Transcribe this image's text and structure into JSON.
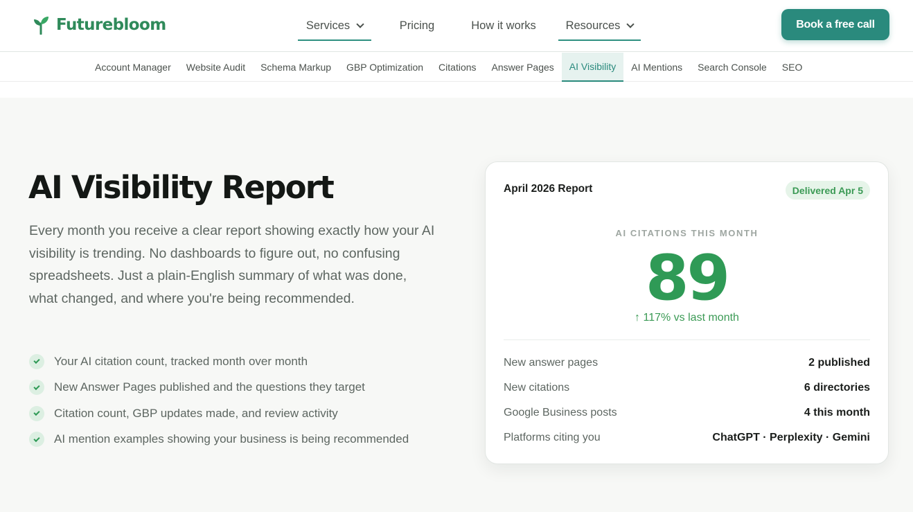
{
  "brand": {
    "name": "Futurebloom",
    "logo_icon": "sprout-icon"
  },
  "nav": {
    "items": [
      {
        "label": "Services",
        "has_dropdown": true
      },
      {
        "label": "Pricing"
      },
      {
        "label": "How it works"
      },
      {
        "label": "Resources",
        "has_dropdown": true
      }
    ],
    "cta_label": "Book a free call"
  },
  "subnav": {
    "items": [
      "Account Manager",
      "Website Audit",
      "Schema Markup",
      "GBP Optimization",
      "Citations",
      "Answer Pages",
      "AI Visibility",
      "AI Mentions",
      "Search Console",
      "SEO"
    ],
    "active": "AI Visibility"
  },
  "hero": {
    "title": "AI Visibility Report",
    "description": "Every month you receive a clear report showing exactly how your AI visibility is trending. No dashboards to figure out, no confusing spreadsheets. Just a plain-English summary of what was done, what changed, and where you're being recommended.",
    "features": [
      "Your AI citation count, tracked month over month",
      "New Answer Pages published and the questions they target",
      "Citation count, GBP updates made, and review activity",
      "AI mention examples showing your business is being recommended"
    ]
  },
  "report_card": {
    "title": "April 2026 Report",
    "badge": "Delivered Apr 5",
    "metric_label": "AI CITATIONS THIS MONTH",
    "metric_value": "89",
    "metric_change": "↑ 117% vs last month",
    "stats": [
      {
        "label": "New answer pages",
        "value": "2 published"
      },
      {
        "label": "New citations",
        "value": "6 directories"
      },
      {
        "label": "Google Business posts",
        "value": "4 this month"
      },
      {
        "label": "Platforms citing you",
        "value": "ChatGPT · Perplexity · Gemini"
      }
    ]
  },
  "colors": {
    "brand_green": "#2f8a5a",
    "accent_teal": "#2a8a7d",
    "metric_green": "#2f9a56"
  }
}
